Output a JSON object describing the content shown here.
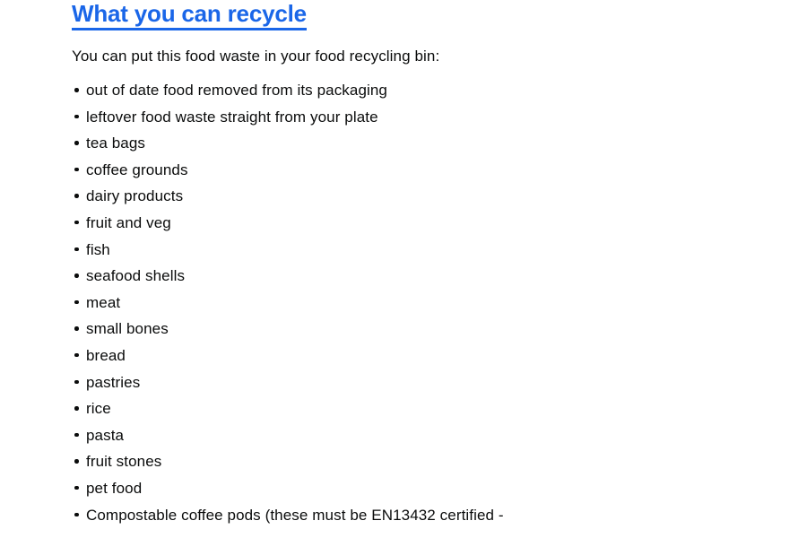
{
  "colors": {
    "link_blue": "#1a66e8",
    "text_black": "#0b0c0c",
    "background": "#ffffff"
  },
  "heading": {
    "text": "What you can recycle"
  },
  "intro": {
    "text": "You can put this food waste in your food recycling bin:"
  },
  "list": {
    "items": [
      {
        "label": "out of date food removed from its packaging"
      },
      {
        "label": "leftover food waste straight from your plate"
      },
      {
        "label": "tea bags"
      },
      {
        "label": "coffee grounds"
      },
      {
        "label": "dairy products"
      },
      {
        "label": "fruit and veg"
      },
      {
        "label": "fish"
      },
      {
        "label": "seafood shells"
      },
      {
        "label": "meat"
      },
      {
        "label": "small bones"
      },
      {
        "label": "bread"
      },
      {
        "label": "pastries"
      },
      {
        "label": "rice"
      },
      {
        "label": "pasta"
      },
      {
        "label": "fruit stones"
      },
      {
        "label": "pet food"
      },
      {
        "label": "Compostable coffee pods (these must be EN13432 certified -"
      }
    ]
  }
}
